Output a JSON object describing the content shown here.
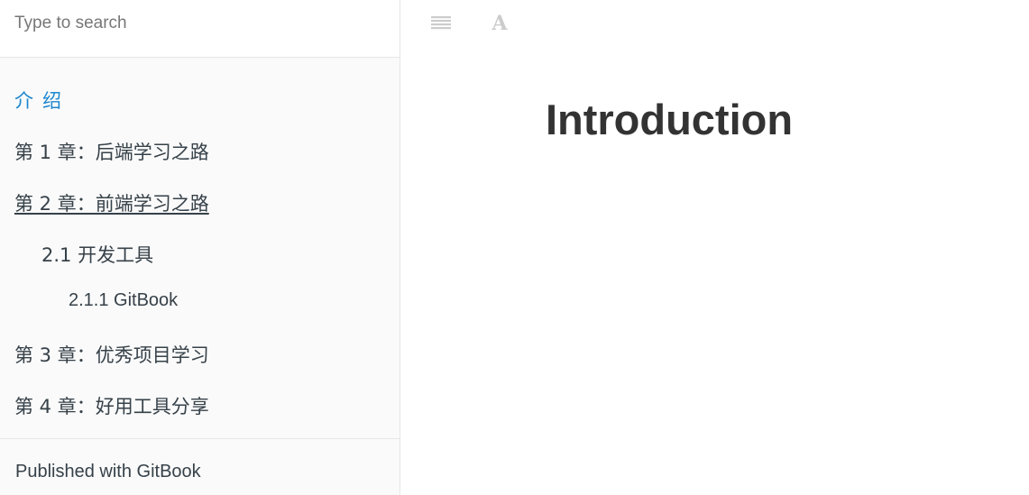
{
  "search": {
    "placeholder": "Type to search"
  },
  "summary": {
    "items": [
      {
        "label": "介绍"
      },
      {
        "label": "第 1 章：后端学习之路"
      },
      {
        "label": "第 2 章：前端学习之路"
      },
      {
        "label": "2.1 开发工具"
      },
      {
        "label": "2.1.1 GitBook"
      },
      {
        "label": "第 3 章：优秀项目学习"
      },
      {
        "label": "第 4 章：好用工具分享"
      }
    ],
    "published": "Published with GitBook"
  },
  "toolbar": {
    "toggle_icon": "menu-lines-icon",
    "font_icon": "font-settings-icon",
    "font_glyph": "A"
  },
  "page": {
    "title": "Introduction"
  },
  "colors": {
    "active_link": "#1e87cf",
    "text": "#364149",
    "sidebar_bg": "#fafafa",
    "icon": "#cccccc"
  }
}
